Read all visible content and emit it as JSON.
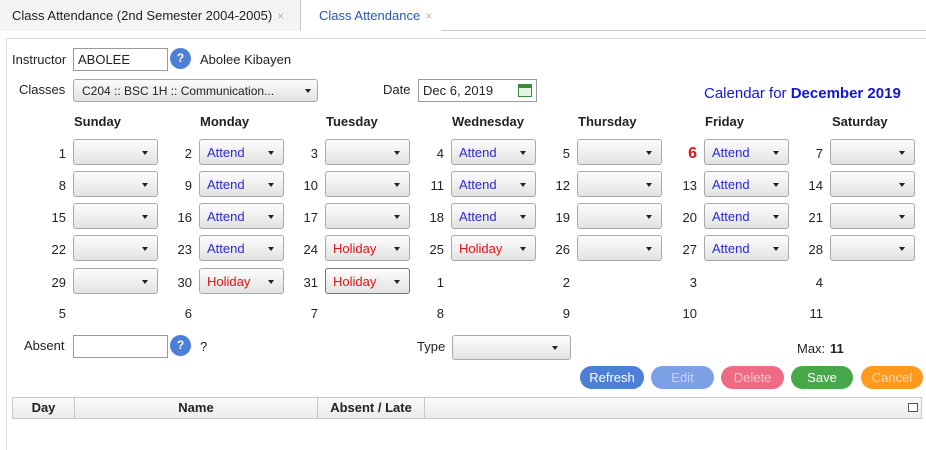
{
  "tabs": [
    {
      "label": "Class Attendance (2nd Semester 2004-2005)",
      "close": "×"
    },
    {
      "label": "Class Attendance",
      "close": "×"
    }
  ],
  "form": {
    "instructor_label": "Instructor",
    "instructor_value": "ABOLEE",
    "instructor_help": "?",
    "instructor_name": "Abolee Kibayen",
    "classes_label": "Classes",
    "classes_value": "C204 :: BSC 1H :: Communication...",
    "date_label": "Date",
    "date_value": "Dec 6, 2019",
    "absent_label": "Absent",
    "absent_value": "",
    "absent_help": "?",
    "absent_name": "?",
    "type_label": "Type",
    "type_value": "",
    "max_label": "Max:",
    "max_value": "11"
  },
  "calendar": {
    "title_prefix": "Calendar for",
    "title_month": "December 2019",
    "days": [
      "Sunday",
      "Monday",
      "Tuesday",
      "Wednesday",
      "Thursday",
      "Friday",
      "Saturday"
    ],
    "weeks": [
      [
        {
          "n": "1",
          "s": ""
        },
        {
          "n": "2",
          "s": "Attend"
        },
        {
          "n": "3",
          "s": ""
        },
        {
          "n": "4",
          "s": "Attend"
        },
        {
          "n": "5",
          "s": ""
        },
        {
          "n": "6",
          "s": "Attend",
          "today": true
        },
        {
          "n": "7",
          "s": ""
        }
      ],
      [
        {
          "n": "8",
          "s": ""
        },
        {
          "n": "9",
          "s": "Attend"
        },
        {
          "n": "10",
          "s": ""
        },
        {
          "n": "11",
          "s": "Attend"
        },
        {
          "n": "12",
          "s": ""
        },
        {
          "n": "13",
          "s": "Attend"
        },
        {
          "n": "14",
          "s": ""
        }
      ],
      [
        {
          "n": "15",
          "s": ""
        },
        {
          "n": "16",
          "s": "Attend"
        },
        {
          "n": "17",
          "s": ""
        },
        {
          "n": "18",
          "s": "Attend"
        },
        {
          "n": "19",
          "s": ""
        },
        {
          "n": "20",
          "s": "Attend"
        },
        {
          "n": "21",
          "s": ""
        }
      ],
      [
        {
          "n": "22",
          "s": ""
        },
        {
          "n": "23",
          "s": "Attend"
        },
        {
          "n": "24",
          "s": "Holiday"
        },
        {
          "n": "25",
          "s": "Holiday"
        },
        {
          "n": "26",
          "s": ""
        },
        {
          "n": "27",
          "s": "Attend"
        },
        {
          "n": "28",
          "s": ""
        }
      ],
      [
        {
          "n": "29",
          "s": ""
        },
        {
          "n": "30",
          "s": "Holiday"
        },
        {
          "n": "31",
          "s": "Holiday",
          "focused": true
        },
        {
          "n": "1",
          "nosel": true
        },
        {
          "n": "2",
          "nosel": true
        },
        {
          "n": "3",
          "nosel": true
        },
        {
          "n": "4",
          "nosel": true
        }
      ],
      [
        {
          "n": "5",
          "nosel": true
        },
        {
          "n": "6",
          "nosel": true
        },
        {
          "n": "7",
          "nosel": true
        },
        {
          "n": "8",
          "nosel": true
        },
        {
          "n": "9",
          "nosel": true
        },
        {
          "n": "10",
          "nosel": true
        },
        {
          "n": "11",
          "nosel": true
        }
      ]
    ]
  },
  "buttons": {
    "refresh": "Refresh",
    "edit": "Edit",
    "delete": "Delete",
    "save": "Save",
    "cancel": "Cancel"
  },
  "grid": {
    "columns": [
      "Day",
      "Name",
      "Absent / Late"
    ]
  },
  "colors": {
    "attend": "#2a2ad0",
    "holiday": "#e01414",
    "today": "#e01414",
    "title": "#1414d8"
  }
}
